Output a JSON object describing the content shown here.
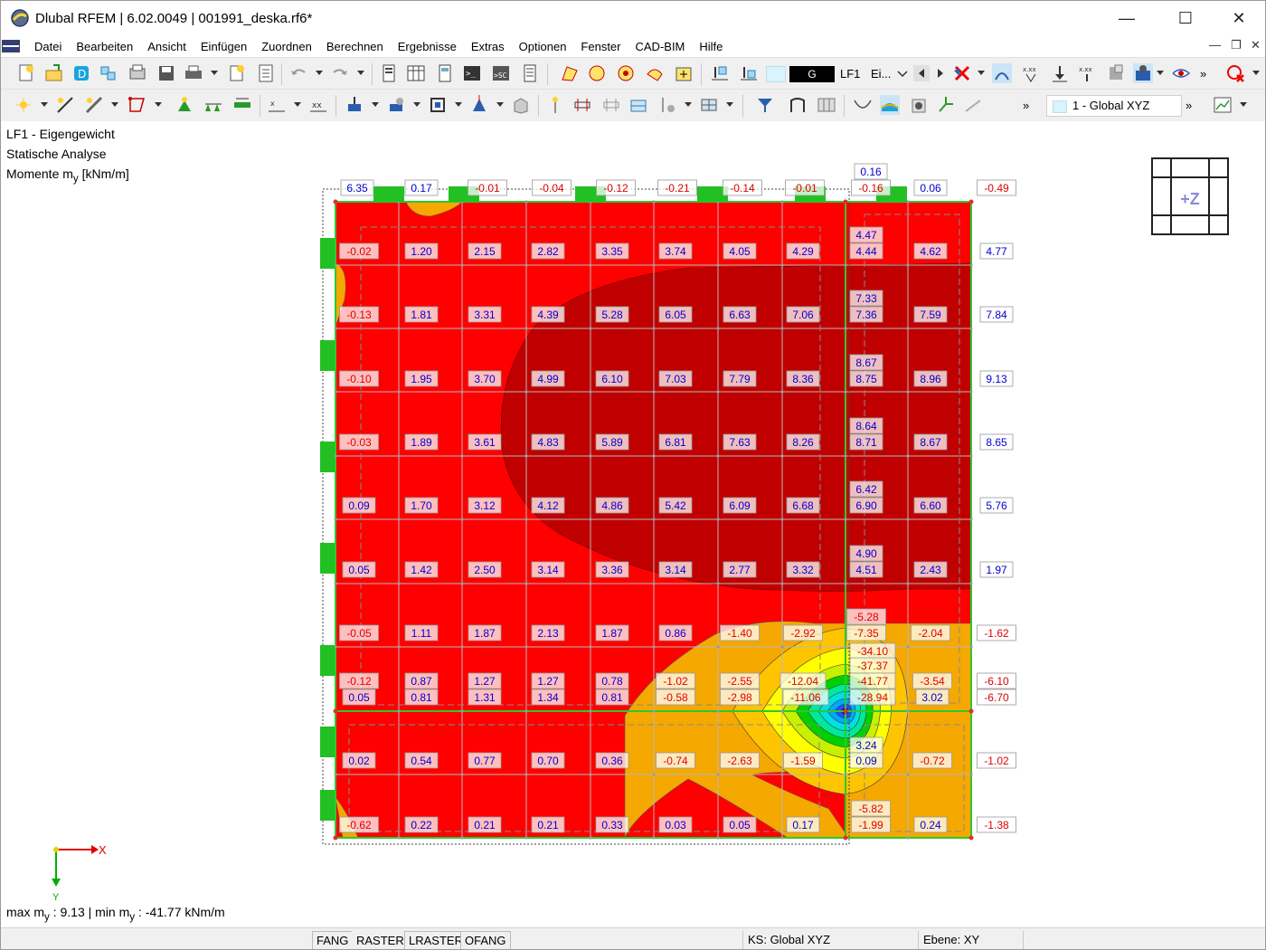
{
  "window": {
    "title": "Dlubal RFEM | 6.02.0049 | 001991_deska.rf6*",
    "controls": {
      "minimize": "—",
      "maximize": "☐",
      "close": "✕"
    }
  },
  "menu": {
    "items": [
      "Datei",
      "Bearbeiten",
      "Ansicht",
      "Einfügen",
      "Zuordnen",
      "Berechnen",
      "Ergebnisse",
      "Extras",
      "Optionen",
      "Fenster",
      "CAD-BIM",
      "Hilfe"
    ]
  },
  "toolbar": {
    "load_case_code": "G",
    "load_case_name": "LF1",
    "load_case_short": "Ei...",
    "coordinate_system": "1 - Global XYZ",
    "more": "»"
  },
  "info": {
    "load_case": "LF1 - Eigengewicht",
    "analysis": "Statische Analyse",
    "result_prefix": "Momente m",
    "result_sub": "y",
    "result_unit": " [kNm/m]"
  },
  "summary": {
    "max_prefix": "max m",
    "max_sub": "y",
    "max_value": " : 9.13 | min m",
    "min_sub": "y",
    "min_value": " : -41.77 kNm/m"
  },
  "axes": {
    "x": "X",
    "y": "Y"
  },
  "navcube": {
    "label": "+Z"
  },
  "statusbar": {
    "buttons": [
      "FANG",
      "RASTER",
      "LRASTER",
      "OFANG"
    ],
    "cs": "KS: Global XYZ",
    "plane": "Ebene: XY"
  },
  "colors": {
    "red": "#ff0000",
    "dark_red": "#c00000",
    "orange": "#f5a800",
    "yellow": "#ffff00",
    "green": "#00d000",
    "support_green": "#22c022",
    "label_red": "#e00000",
    "label_blue": "#0000d0"
  },
  "result_values": {
    "top_row": [
      "6.35",
      "0.17",
      "-0.01",
      "-0.04",
      "-0.12",
      "-0.21",
      "-0.14",
      "-0.01",
      "0.16",
      "-0.16",
      "0.06",
      "-0.49"
    ],
    "rows": [
      [
        "-0.02",
        "1.20",
        "2.15",
        "2.82",
        "3.35",
        "3.74",
        "4.05",
        "4.29",
        "4.47",
        "4.44",
        "4.62",
        "4.77"
      ],
      [
        "-0.13",
        "1.81",
        "3.31",
        "4.39",
        "5.28",
        "6.05",
        "6.63",
        "7.06",
        "7.33",
        "7.36",
        "7.59",
        "7.84"
      ],
      [
        "-0.10",
        "1.95",
        "3.70",
        "4.99",
        "6.10",
        "7.03",
        "7.79",
        "8.36",
        "8.67",
        "8.75",
        "8.96",
        "9.13"
      ],
      [
        "-0.03",
        "1.89",
        "3.61",
        "4.83",
        "5.89",
        "6.81",
        "7.63",
        "8.26",
        "8.64",
        "8.71",
        "8.67",
        "8.65"
      ],
      [
        "0.09",
        "1.70",
        "3.12",
        "4.12",
        "4.86",
        "5.42",
        "6.09",
        "6.68",
        "6.42",
        "6.90",
        "6.60",
        "5.76"
      ],
      [
        "0.05",
        "1.42",
        "2.50",
        "3.14",
        "3.36",
        "3.14",
        "2.77",
        "3.32",
        "4.90",
        "4.51",
        "2.43",
        "1.97"
      ],
      [
        "-0.05",
        "1.11",
        "1.87",
        "2.13",
        "1.87",
        "0.86",
        "-1.40",
        "-2.92",
        "-5.28",
        "-7.35",
        "-2.04",
        "-1.62"
      ],
      [
        "-0.12",
        "0.87",
        "1.27",
        "1.27",
        "0.78",
        "-1.02",
        "-2.55",
        "-12.04",
        "-34.10",
        "-37.37",
        "-41.77",
        "-3.54",
        "-6.10"
      ],
      [
        "0.05",
        "0.81",
        "1.31",
        "1.34",
        "0.81",
        "-0.58",
        "-2.98",
        "-11.06",
        "-28.94",
        "3.02",
        "-6.70"
      ],
      [
        "0.02",
        "0.54",
        "0.77",
        "0.70",
        "0.36",
        "-0.74",
        "-2.63",
        "-1.59",
        "3.24",
        "0.09",
        "-0.72",
        "-1.02"
      ],
      [
        "-0.62",
        "0.22",
        "0.21",
        "0.21",
        "0.33",
        "0.03",
        "0.05",
        "0.17",
        "-5.82",
        "-1.99",
        "0.24",
        "-1.38"
      ]
    ]
  }
}
